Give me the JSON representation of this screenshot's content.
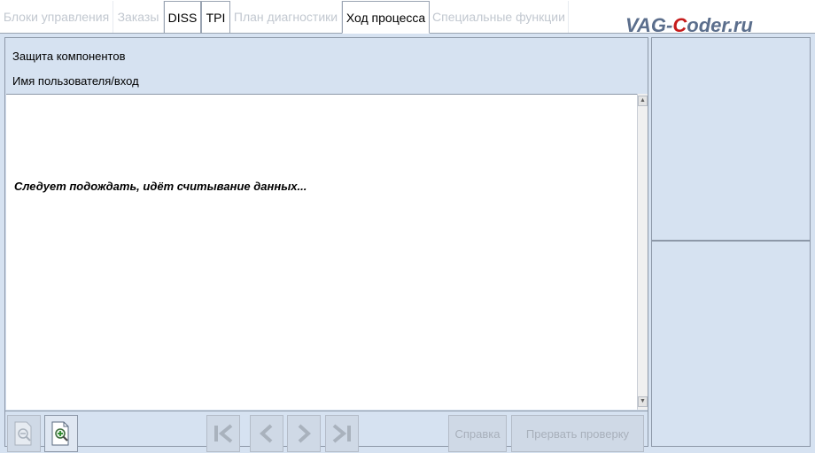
{
  "tabs": [
    {
      "label": "Блоки управления",
      "state": "disabled"
    },
    {
      "label": "Заказы",
      "state": "disabled"
    },
    {
      "label": "DISS",
      "state": "enabled"
    },
    {
      "label": "TPI",
      "state": "enabled"
    },
    {
      "label": "План диагностики",
      "state": "disabled"
    },
    {
      "label": "Ход процесса",
      "state": "active"
    },
    {
      "label": "Специальные функции",
      "state": "disabled"
    }
  ],
  "watermark": {
    "part1": "VAG-",
    "part2": "C",
    "part3": "oder.ru"
  },
  "header": {
    "line1": "Защита компонентов",
    "line2": "Имя пользователя/вход"
  },
  "content": {
    "message": "Следует подождать, идёт считывание данных..."
  },
  "toolbar": {
    "zoom_out_icon": "zoom-out-icon",
    "zoom_in_icon": "zoom-in-icon",
    "first_icon": "skip-first-icon",
    "prev_icon": "chevron-left-icon",
    "next_icon": "chevron-right-icon",
    "last_icon": "skip-last-icon",
    "help_label": "Справка",
    "abort_label": "Прервать проверку"
  },
  "colors": {
    "panel_bg": "#d6e2f1",
    "border": "#8d98a8",
    "disabled_text": "#c2c8d0",
    "watermark_blue": "#5b6e8c",
    "watermark_red": "#c61c1c"
  }
}
